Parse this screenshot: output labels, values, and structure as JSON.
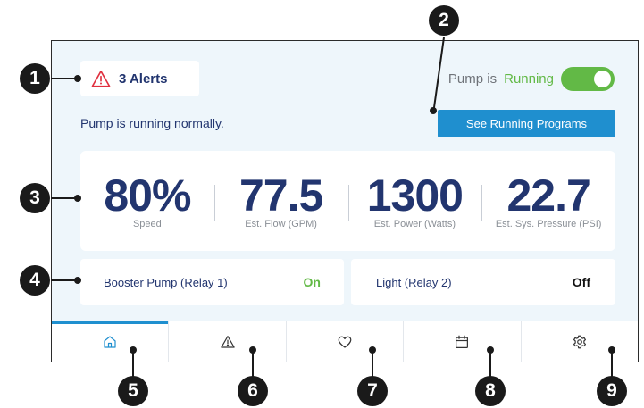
{
  "alerts": {
    "label": "3 Alerts"
  },
  "pump": {
    "prefix": "Pump is",
    "state": "Running"
  },
  "status_message": "Pump is running normally.",
  "programs_button": "See Running Programs",
  "stats": [
    {
      "value": "80%",
      "label": "Speed"
    },
    {
      "value": "77.5",
      "label": "Est. Flow (GPM)"
    },
    {
      "value": "1300",
      "label": "Est. Power (Watts)"
    },
    {
      "value": "22.7",
      "label": "Est. Sys. Pressure (PSI)"
    }
  ],
  "relays": [
    {
      "label": "Booster Pump (Relay 1)",
      "state": "On"
    },
    {
      "label": "Light (Relay 2)",
      "state": "Off"
    }
  ],
  "nav": [
    {
      "icon": "home-icon"
    },
    {
      "icon": "warning-icon"
    },
    {
      "icon": "heart-icon"
    },
    {
      "icon": "calendar-icon"
    },
    {
      "icon": "gear-icon"
    }
  ],
  "callouts": [
    "1",
    "2",
    "3",
    "4",
    "5",
    "6",
    "7",
    "8",
    "9"
  ],
  "colors": {
    "navy": "#22356f",
    "green": "#62b946",
    "blue": "#1f8fcf",
    "alert_red": "#e0303f"
  }
}
